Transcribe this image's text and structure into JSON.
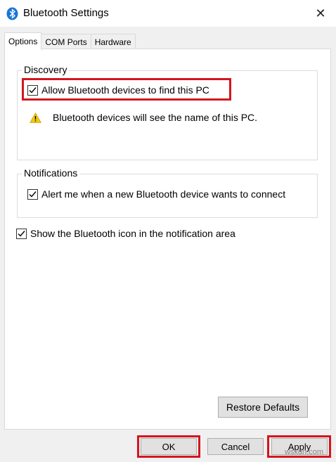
{
  "window": {
    "title": "Bluetooth Settings",
    "close_glyph": "✕"
  },
  "tabs": [
    {
      "label": "Options",
      "active": true
    },
    {
      "label": "COM Ports",
      "active": false
    },
    {
      "label": "Hardware",
      "active": false
    }
  ],
  "discovery": {
    "group_label": "Discovery",
    "allow_find": {
      "label": "Allow Bluetooth devices to find this PC",
      "checked": true
    },
    "warning_text": "Bluetooth devices will see the name of this PC."
  },
  "notifications": {
    "group_label": "Notifications",
    "alert_new_device": {
      "label": "Alert me when a new Bluetooth device wants to connect",
      "checked": true
    }
  },
  "show_icon": {
    "label": "Show the Bluetooth icon in the notification area",
    "checked": true
  },
  "buttons": {
    "restore_defaults": "Restore Defaults",
    "ok": "OK",
    "cancel": "Cancel",
    "apply": "Apply"
  },
  "watermark": "wsxdn.com",
  "colors": {
    "highlight": "#d4151f",
    "bluetooth_icon": "#1a74d8",
    "warning_icon": "#f2c811"
  },
  "icons": {
    "app": "bluetooth-icon",
    "close": "close-icon",
    "warning": "warning-icon",
    "checkmark": "checkmark-icon"
  }
}
